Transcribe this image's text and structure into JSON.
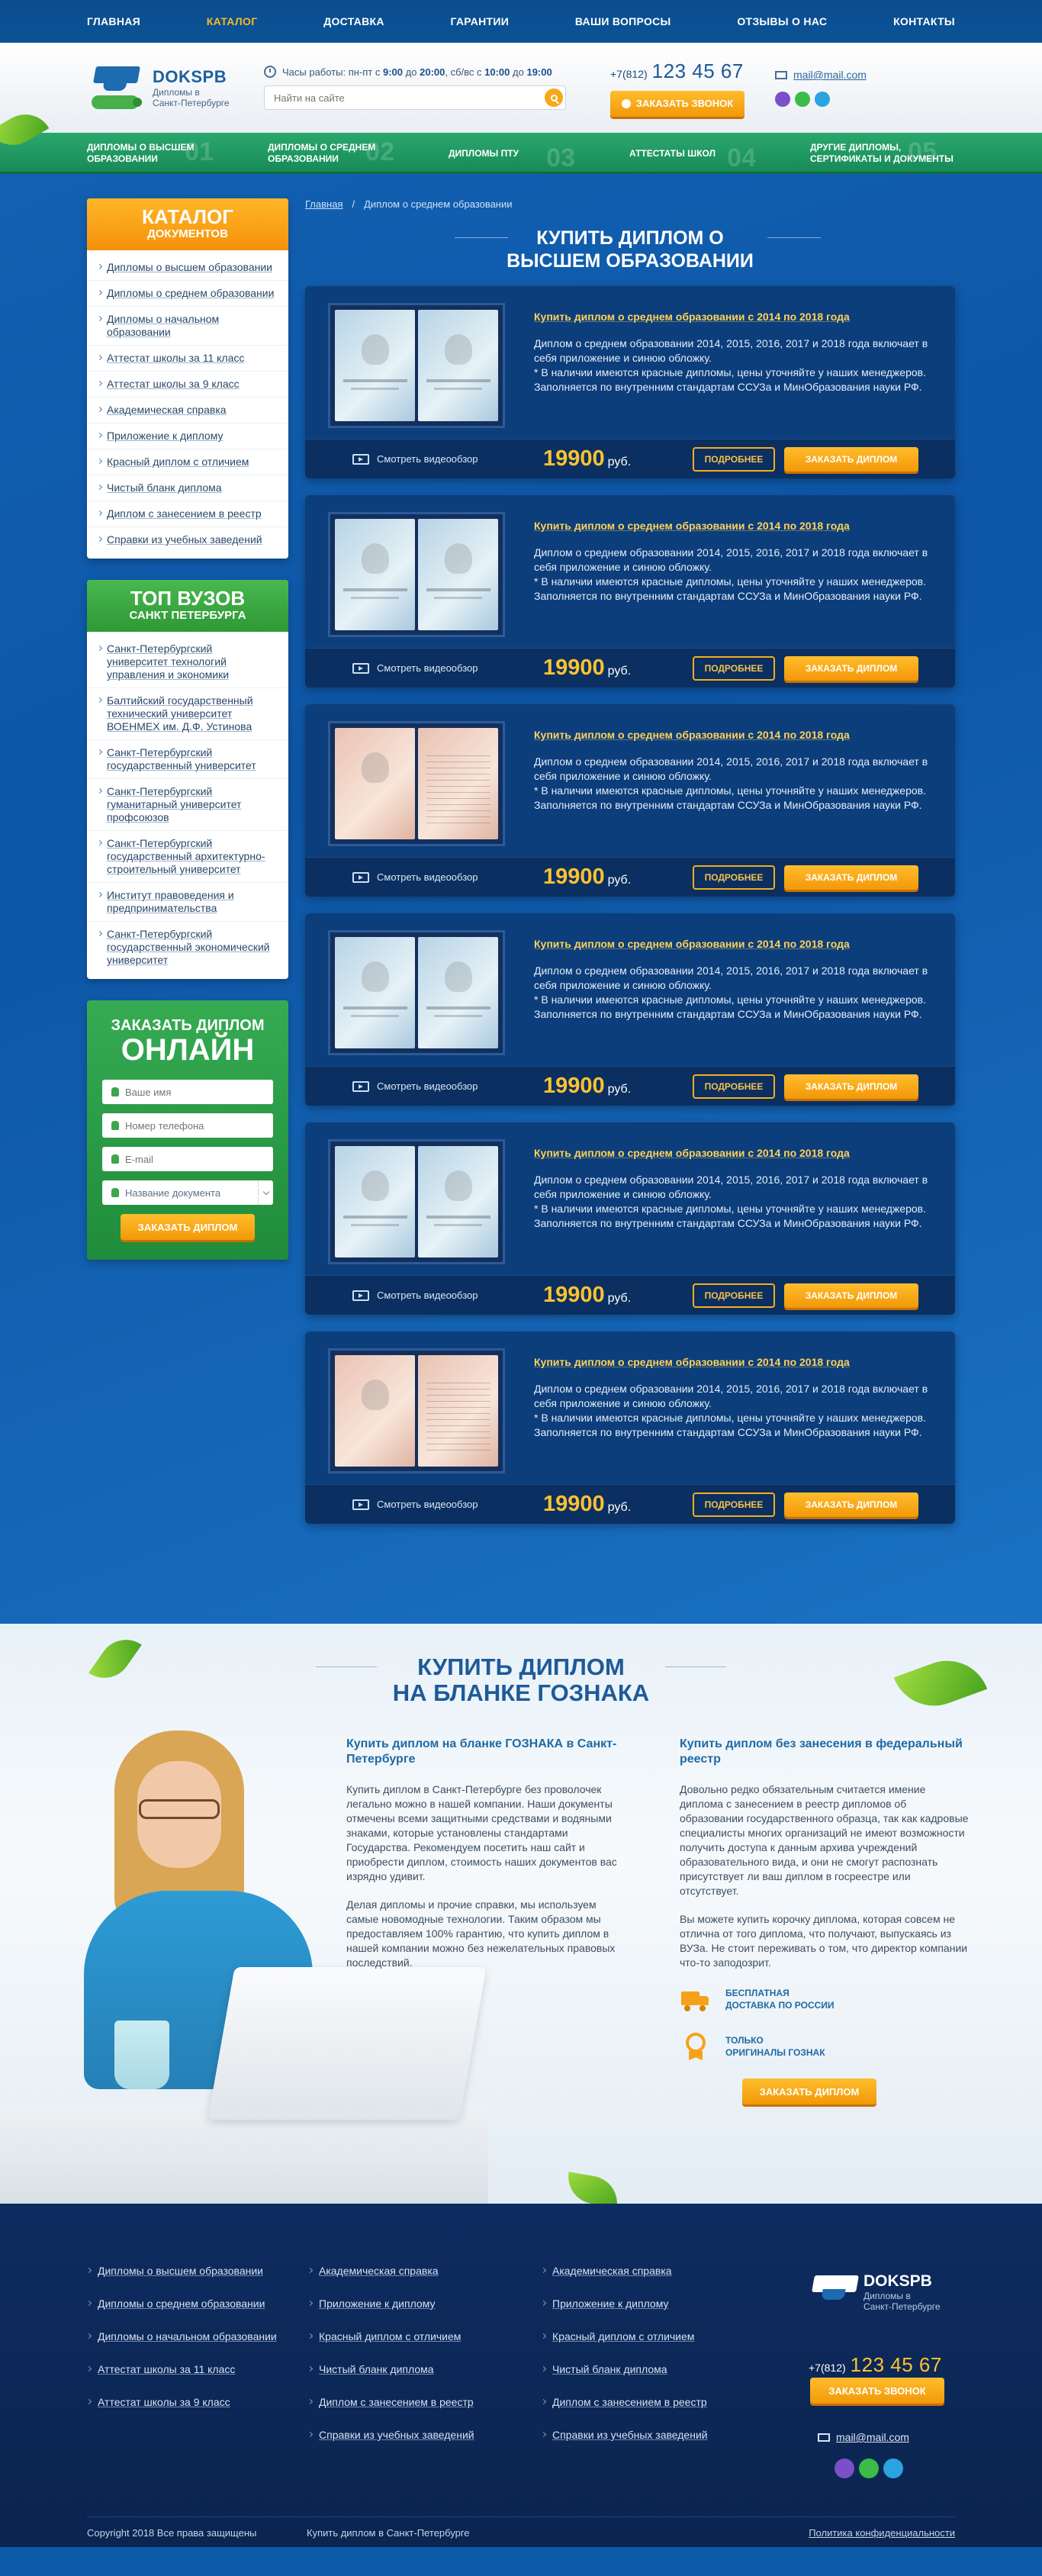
{
  "nav": {
    "items": [
      {
        "label": "ГЛАВНАЯ"
      },
      {
        "label": "КАТАЛОГ"
      },
      {
        "label": "ДОСТАВКА"
      },
      {
        "label": "ГАРАНТИИ"
      },
      {
        "label": "ВАШИ ВОПРОСЫ"
      },
      {
        "label": "ОТЗЫВЫ О НАС"
      },
      {
        "label": "КОНТАКТЫ"
      }
    ],
    "active_color": "#f7b925"
  },
  "header": {
    "brand": "DOKSPB",
    "tagline_1": "Дипломы в",
    "tagline_2": "Санкт-Петербурге",
    "hours_prefix": "Часы работы: пн-пт с",
    "hours_weekday_from": "9:00",
    "hours_to_word": "до",
    "hours_weekday_to": "20:00",
    "hours_weekend_prefix": ", сб/вс с",
    "hours_weekend_from": "10:00",
    "hours_weekend_to": "19:00",
    "search_placeholder": "Найти на сайте",
    "phone_code": "+7(812)",
    "phone_number": "123 45 67",
    "callback_label": "ЗАКАЗАТЬ ЗВОНОК",
    "email": "mail@mail.com",
    "messenger_icons": [
      "viber-icon",
      "whatsapp-icon",
      "telegram-icon"
    ]
  },
  "categories": [
    {
      "label_1": "ДИПЛОМЫ О ВЫСШЕМ",
      "label_2": "ОБРАЗОВАНИИ",
      "num": "01"
    },
    {
      "label_1": "ДИПЛОМЫ О СРЕДНЕМ",
      "label_2": "ОБРАЗОВАНИИ",
      "num": "02"
    },
    {
      "label_1": "ДИПЛОМЫ ПТУ",
      "label_2": "",
      "num": "03"
    },
    {
      "label_1": "АТТЕСТАТЫ ШКОЛ",
      "label_2": "",
      "num": "04"
    },
    {
      "label_1": "ДРУГИЕ ДИПЛОМЫ,",
      "label_2": "СЕРТИФИКАТЫ И ДОКУМЕНТЫ",
      "num": "05"
    }
  ],
  "sidebar": {
    "catalog_title_1": "КАТАЛОГ",
    "catalog_title_2": "ДОКУМЕНТОВ",
    "catalog_items": [
      "Дипломы о высшем образовании",
      "Дипломы о среднем образовании",
      "Дипломы о начальном образовании",
      "Аттестат школы за 11 класс",
      "Аттестат школы за 9 класс",
      "Академическая справка",
      "Приложение к диплому",
      "Красный диплом с отличием",
      "Чистый бланк диплома",
      "Диплом с занесением в реестр",
      "Справки из учебных заведений"
    ],
    "top_title_1": "ТОП ВУЗОВ",
    "top_title_2": "САНКТ ПЕТЕРБУРГА",
    "top_items": [
      "Санкт-Петербургский университет технологий управления и экономики",
      "Балтийский государственный технический университет ВОЕНМЕХ им. Д.Ф. Устинова",
      "Санкт-Петербургский государственный университет",
      "Санкт-Петербургский гуманитарный университет профсоюзов",
      "Санкт-Петербургский государственный архитектурно-строительный университет",
      "Институт правоведения и предпринимательства",
      "Санкт-Петербургский государственный экономический университет"
    ],
    "order": {
      "title_1": "ЗАКАЗАТЬ ДИПЛОМ",
      "title_2": "ОНЛАЙН",
      "name_placeholder": "Ваше имя",
      "phone_placeholder": "Номер телефона",
      "email_placeholder": "E-mail",
      "doc_select": "Название документа",
      "submit_label": "ЗАКАЗАТЬ ДИПЛОМ"
    }
  },
  "breadcrumb": {
    "home": "Главная",
    "sep": "/",
    "current": "Диплом о среднем образовании"
  },
  "section_title_1": "КУПИТЬ ДИПЛОМ О",
  "section_title_2": "ВЫСШЕМ ОБРАЗОВАНИИ",
  "products": [
    {
      "title": "Купить диплом о среднем образовании с 2014 по 2018 года",
      "desc": "Диплом о среднем образовании 2014, 2015, 2016, 2017 и 2018 года включает в себя приложение и синюю обложку.\n* В наличии имеются красные дипломы, цены уточняйте у наших менеджеров. Заполняется по внутренним стандартам ССУЗа и МинОбразования науки РФ.",
      "video": "Смотреть видеообзор",
      "price": "19900",
      "currency": "руб.",
      "more": "ПОДРОБНЕЕ",
      "order": "ЗАКАЗАТЬ ДИПЛОМ",
      "style": "blue-open"
    },
    {
      "title": "Купить диплом о среднем образовании с 2014 по 2018 года",
      "desc": "Диплом о среднем образовании 2014, 2015, 2016, 2017 и 2018 года включает в себя приложение и синюю обложку.\n* В наличии имеются красные дипломы, цены уточняйте у наших менеджеров. Заполняется по внутренним стандартам ССУЗа и МинОбразования науки РФ.",
      "video": "Смотреть видеообзор",
      "price": "19900",
      "currency": "руб.",
      "more": "ПОДРОБНЕЕ",
      "order": "ЗАКАЗАТЬ ДИПЛОМ",
      "style": "blue"
    },
    {
      "title": "Купить диплом о среднем образовании с 2014 по 2018 года",
      "desc": "Диплом о среднем образовании 2014, 2015, 2016, 2017 и 2018 года включает в себя приложение и синюю обложку.\n* В наличии имеются красные дипломы, цены уточняйте у наших менеджеров. Заполняется по внутренним стандартам ССУЗа и МинОбразования науки РФ.",
      "video": "Смотреть видеообзор",
      "price": "19900",
      "currency": "руб.",
      "more": "ПОДРОБНЕЕ",
      "order": "ЗАКАЗАТЬ ДИПЛОМ",
      "style": "pink"
    },
    {
      "title": "Купить диплом о среднем образовании с 2014 по 2018 года",
      "desc": "Диплом о среднем образовании 2014, 2015, 2016, 2017 и 2018 года включает в себя приложение и синюю обложку.\n* В наличии имеются красные дипломы, цены уточняйте у наших менеджеров. Заполняется по внутренним стандартам ССУЗа и МинОбразования науки РФ.",
      "video": "Смотреть видеообзор",
      "price": "19900",
      "currency": "руб.",
      "more": "ПОДРОБНЕЕ",
      "order": "ЗАКАЗАТЬ ДИПЛОМ",
      "style": "blue-open"
    },
    {
      "title": "Купить диплом о среднем образовании с 2014 по 2018 года",
      "desc": "Диплом о среднем образовании 2014, 2015, 2016, 2017 и 2018 года включает в себя приложение и синюю обложку.\n* В наличии имеются красные дипломы, цены уточняйте у наших менеджеров. Заполняется по внутренним стандартам ССУЗа и МинОбразования науки РФ.",
      "video": "Смотреть видеообзор",
      "price": "19900",
      "currency": "руб.",
      "more": "ПОДРОБНЕЕ",
      "order": "ЗАКАЗАТЬ ДИПЛОМ",
      "style": "blue"
    },
    {
      "title": "Купить диплом о среднем образовании с 2014 по 2018 года",
      "desc": "Диплом о среднем образовании 2014, 2015, 2016, 2017 и 2018 года включает в себя приложение и синюю обложку.\n* В наличии имеются красные дипломы, цены уточняйте у наших менеджеров. Заполняется по внутренним стандартам ССУЗа и МинОбразования науки РФ.",
      "video": "Смотреть видеообзор",
      "price": "19900",
      "currency": "руб.",
      "more": "ПОДРОБНЕЕ",
      "order": "ЗАКАЗАТЬ ДИПЛОМ",
      "style": "pink"
    }
  ],
  "goznak": {
    "title_1": "КУПИТЬ ДИПЛОМ",
    "title_2": "НА БЛАНКЕ ГОЗНАКА",
    "left_heading": "Купить диплом на бланке ГОЗНАКА в Санкт-Петербурге",
    "left_p1": "Купить диплом в Санкт-Петербурге без проволочек легально можно в нашей компании. Наши документы отмечены всеми защитными средствами и водяными знаками, которые установлены стандартами Государства. Рекомендуем посетить наш сайт и приобрести диплом, стоимость наших документов вас изрядно удивит.",
    "left_p2": "Делая дипломы и прочие справки, мы используем самые новомодные технологии. Таким образом мы предоставляем 100% гарантию, что купить диплом в нашей компании можно без нежелательных правовых последствий.",
    "right_heading": "Купить диплом без занесения в федеральный реестр",
    "right_p1": "Довольно редко обязательным считается имение диплома с занесением в реестр дипломов об образовании государственного образца, так как кадровые специалисты многих организаций не имеют возможности получить доступа к данным архива учреждений образовательного вида, и они не смогут распознать присутствует ли ваш диплом в госреестре или отсутствует.",
    "right_p2": "Вы можете купить корочку диплома, которая совсем не отлична от того диплома, что получают, выпускаясь из ВУЗа. Не стоит переживать о том, что директор компании что-то заподозрит.",
    "feat1_1": "БЕСПЛАТНАЯ",
    "feat1_2": "ДОСТАВКА ПО РОССИИ",
    "feat2_1": "ТОЛЬКО",
    "feat2_2": "ОРИГИНАЛЫ ГОЗНАК",
    "button": "ЗАКАЗАТЬ ДИПЛОМ"
  },
  "footer": {
    "col1": [
      "Дипломы о высшем образовании",
      "Дипломы о среднем образовании",
      "Дипломы о начальном образовании",
      "Аттестат школы за 11 класс",
      "Аттестат школы за 9 класс"
    ],
    "col2": [
      "Академическая справка",
      "Приложение к диплому",
      "Красный диплом с отличием",
      "Чистый бланк диплома",
      "Диплом с занесением в реестр",
      "Справки из учебных заведений"
    ],
    "col3": [
      "Академическая справка",
      "Приложение к диплому",
      "Красный диплом с отличием",
      "Чистый бланк диплома",
      "Диплом с занесением в реестр",
      "Справки из учебных заведений"
    ],
    "brand": "DOKSPB",
    "tagline_1": "Дипломы в",
    "tagline_2": "Санкт-Петербурге",
    "phone_code": "+7(812)",
    "phone_number": "123 45 67",
    "callback_label": "ЗАКАЗАТЬ ЗВОНОК",
    "email": "mail@mail.com",
    "copyright": "Copyright 2018 Все права защищены",
    "city": "Купить диплом в Санкт-Петербурге",
    "privacy": "Политика конфиденциальности"
  }
}
